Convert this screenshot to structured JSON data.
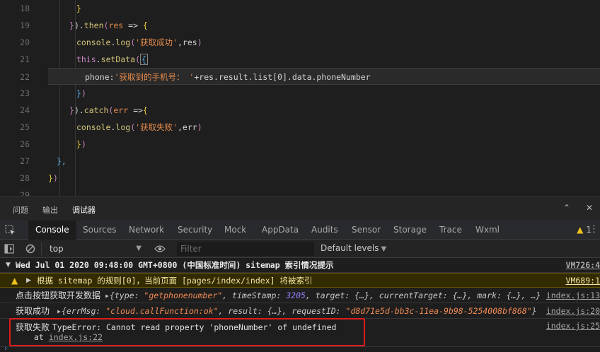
{
  "editor": {
    "lines": [
      {
        "num": "18",
        "code": [
          {
            "t": "}",
            "c": "c-yellow"
          }
        ]
      },
      {
        "num": "19",
        "code": [
          {
            "t": "}",
            "c": "c-purple"
          },
          {
            "t": ").",
            "c": "c-plain"
          },
          {
            "t": "then",
            "c": "c-fn"
          },
          {
            "t": "(",
            "c": "c-purple"
          },
          {
            "t": "res",
            "c": "c-orange"
          },
          {
            "t": " => ",
            "c": "c-arrow"
          },
          {
            "t": "{",
            "c": "c-yellow"
          }
        ]
      },
      {
        "num": "20",
        "code": [
          {
            "t": "console",
            "c": "c-fn"
          },
          {
            "t": ".",
            "c": "c-plain"
          },
          {
            "t": "log",
            "c": "c-fn"
          },
          {
            "t": "(",
            "c": "c-purple"
          },
          {
            "t": "'获取成功'",
            "c": "c-str"
          },
          {
            "t": ",res",
            "c": "c-plain"
          },
          {
            "t": ")",
            "c": "c-purple"
          }
        ]
      },
      {
        "num": "21",
        "code": [
          {
            "t": "this",
            "c": "c-this"
          },
          {
            "t": ".",
            "c": "c-plain"
          },
          {
            "t": "setData",
            "c": "c-fn"
          },
          {
            "t": "(",
            "c": "c-purple"
          },
          {
            "t": "{",
            "c": "c-blue",
            "box": true
          }
        ]
      },
      {
        "num": "22",
        "code": [
          {
            "t": "phone",
            "c": "c-plain"
          },
          {
            "t": ":",
            "c": "c-plain"
          },
          {
            "t": "'获取到的手机号： '",
            "c": "c-str"
          },
          {
            "t": "+res.result.list[0].data.phoneNumber",
            "c": "c-plain"
          }
        ]
      },
      {
        "num": "23",
        "code": [
          {
            "t": "}",
            "c": "c-blue"
          },
          {
            "t": ")",
            "c": "c-purple"
          }
        ]
      },
      {
        "num": "24",
        "code": [
          {
            "t": "}",
            "c": "c-purple"
          },
          {
            "t": ").",
            "c": "c-plain"
          },
          {
            "t": "catch",
            "c": "c-fn"
          },
          {
            "t": "(",
            "c": "c-purple"
          },
          {
            "t": "err",
            "c": "c-orange"
          },
          {
            "t": " =>",
            "c": "c-arrow"
          },
          {
            "t": "{",
            "c": "c-yellow"
          }
        ]
      },
      {
        "num": "25",
        "code": [
          {
            "t": "console",
            "c": "c-fn"
          },
          {
            "t": ".",
            "c": "c-plain"
          },
          {
            "t": "log",
            "c": "c-fn"
          },
          {
            "t": "(",
            "c": "c-purple"
          },
          {
            "t": "'获取失败'",
            "c": "c-str"
          },
          {
            "t": ",err",
            "c": "c-plain"
          },
          {
            "t": ")",
            "c": "c-purple"
          }
        ]
      },
      {
        "num": "26",
        "code": [
          {
            "t": "}",
            "c": "c-yellow"
          },
          {
            "t": ")",
            "c": "c-purple"
          }
        ]
      },
      {
        "num": "27",
        "code": [
          {
            "t": "},",
            "c": "c-blue"
          }
        ]
      },
      {
        "num": "28",
        "code": [
          {
            "t": "}",
            "c": "c-yellow"
          },
          {
            "t": ")",
            "c": "c-purple"
          }
        ]
      },
      {
        "num": "29",
        "code": []
      }
    ]
  },
  "panel_tabs": [
    "问题",
    "输出",
    "调试器"
  ],
  "devtools": {
    "tabs": [
      "Console",
      "Sources",
      "Network",
      "Security",
      "Mock",
      "AppData",
      "Audits",
      "Sensor",
      "Storage",
      "Trace",
      "Wxml"
    ],
    "warning_count": "1"
  },
  "toolbar": {
    "context": "top",
    "filter_placeholder": "Filter",
    "levels": "Default levels"
  },
  "console": {
    "group": {
      "text": "Wed Jul 01 2020 09:48:00 GMT+0800 (中国标准时间) sitemap 索引情况提示",
      "source": "VM726:4"
    },
    "warning": {
      "text": "根据 sitemap 的规则[0]，当前页面 [pages/index/index] 将被索引",
      "source": "VM689:1"
    },
    "log1": {
      "label": "点击按钮获取开发数据",
      "source": "index.js:13",
      "parts": [
        {
          "t": "{",
          "c": "k"
        },
        {
          "t": "type: ",
          "c": "k"
        },
        {
          "t": "\"getphonenumber\"",
          "c": "s"
        },
        {
          "t": ", timeStamp: ",
          "c": "k"
        },
        {
          "t": "3205",
          "c": "n"
        },
        {
          "t": ", target: {…}, currentTarget: {…}, mark: {…}, …}",
          "c": "k"
        }
      ]
    },
    "log2": {
      "label": "获取成功",
      "source": "index.js:20",
      "parts": [
        {
          "t": "{errMsg: ",
          "c": "k"
        },
        {
          "t": "\"cloud.callFunction:ok\"",
          "c": "s"
        },
        {
          "t": ", result: {…}, requestID: ",
          "c": "k"
        },
        {
          "t": "\"d8d71e5d-bb3c-11ea-9b98-5254008bf868\"",
          "c": "s"
        },
        {
          "t": "}",
          "c": "k"
        }
      ]
    },
    "error": {
      "label": "获取失败",
      "message": "TypeError: Cannot read property 'phoneNumber' of undefined",
      "at": "at",
      "link": "index.js:22",
      "source": "index.js:25"
    }
  },
  "colors": {
    "highlight_box": "#e01b1b",
    "warning_bg": "#332b00",
    "active_tab_line": "#6aa0ff"
  }
}
